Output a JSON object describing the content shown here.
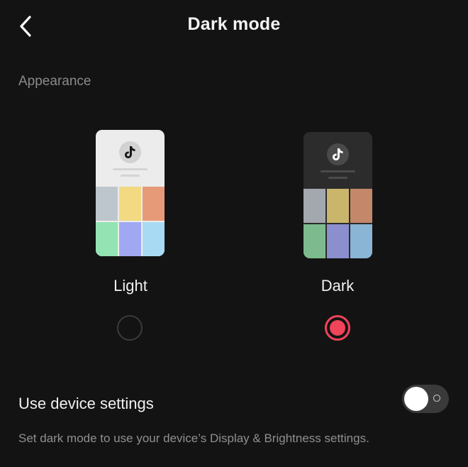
{
  "header": {
    "title": "Dark mode",
    "back_icon": "chevron-left-icon"
  },
  "appearance": {
    "section_label": "Appearance",
    "options": [
      {
        "id": "light",
        "label": "Light",
        "selected": false,
        "preview_background": "#ececec",
        "tile_colors": [
          "#bec6cd",
          "#f2d982",
          "#e69a78",
          "#93e3b3",
          "#a1a8f2",
          "#a9daf4"
        ]
      },
      {
        "id": "dark",
        "label": "Dark",
        "selected": true,
        "preview_background": "#2c2c2c",
        "tile_colors": [
          "#a2a8ae",
          "#c9b66c",
          "#c4876a",
          "#7dbb8e",
          "#8c8fcd",
          "#8ab5d4"
        ]
      }
    ],
    "app_logo_icon": "tiktok-note-icon"
  },
  "device_setting": {
    "label": "Use device settings",
    "enabled": false,
    "description": "Set dark mode to use your device’s Display & Brightness settings."
  },
  "colors": {
    "background": "#131313",
    "accent": "#f04458",
    "text_primary": "#f0f0f0",
    "text_secondary": "#8a8a8a"
  }
}
